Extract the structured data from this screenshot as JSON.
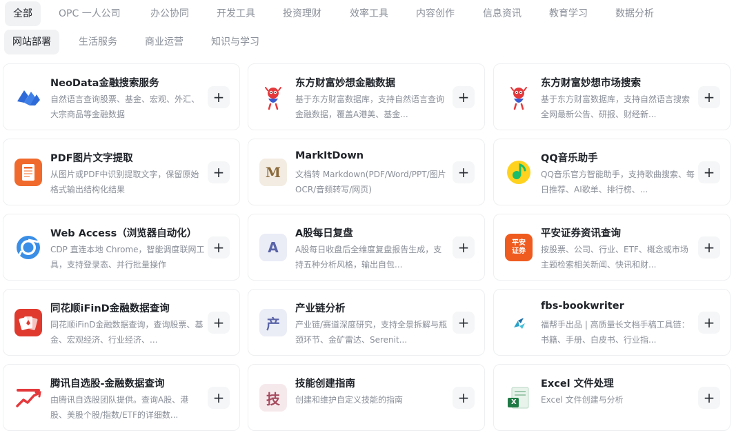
{
  "tabs": [
    {
      "label": "全部",
      "active": true
    },
    {
      "label": "OPC 一人公司"
    },
    {
      "label": "办公协同"
    },
    {
      "label": "开发工具"
    },
    {
      "label": "投资理财"
    },
    {
      "label": "效率工具"
    },
    {
      "label": "内容创作"
    },
    {
      "label": "信息资讯"
    },
    {
      "label": "教育学习"
    },
    {
      "label": "数据分析"
    },
    {
      "label": "网站部署"
    },
    {
      "label": "生活服务"
    },
    {
      "label": "商业运营"
    },
    {
      "label": "知识与学习"
    }
  ],
  "add_symbol": "+",
  "cards": [
    {
      "title": "NeoData金融搜索服务",
      "desc": "自然语言查询股票、基金、宏观、外汇、大宗商品等金融数据",
      "icon": "neodata-logo"
    },
    {
      "title": "东方财富妙想金融数据",
      "desc": "基于东方财富数据库，支持自然语言查询金融数据，覆盖A港美、基金...",
      "icon": "eastmoney-mascot"
    },
    {
      "title": "东方财富妙想市场搜索",
      "desc": "基于东方财富数据库，支持自然语言搜索全网最新公告、研报、财经新...",
      "icon": "eastmoney-mascot"
    },
    {
      "title": "PDF图片文字提取",
      "desc": "从图片或PDF中识别提取文字，保留原始格式输出结构化结果",
      "icon": "document-icon"
    },
    {
      "title": "MarkItDown",
      "desc": "文档转 Markdown(PDF/Word/PPT/图片OCR/音频转写/网页)",
      "icon": "letter",
      "letter": "M"
    },
    {
      "title": "QQ音乐助手",
      "desc": "QQ音乐官方智能助手，支持歌曲搜索、每日推荐、AI歌单、排行榜、...",
      "icon": "qqmusic-logo"
    },
    {
      "title": "Web Access（浏览器自动化）",
      "desc": "CDP 直连本地 Chrome，智能调度联网工具，支持登录态、并行批量操作",
      "icon": "chrome-icon"
    },
    {
      "title": "A股每日复盘",
      "desc": "A股每日收盘后全维度复盘报告生成，支持五种分析风格，输出自包...",
      "icon": "letter",
      "letter": "A"
    },
    {
      "title": "平安证券资讯查询",
      "desc": "按股票、公司、行业、ETF、概念或市场主题检索相关新闻、快讯和财...",
      "icon": "pingan-logo",
      "logo_line1": "平安",
      "logo_line2": "证券"
    },
    {
      "title": "同花顺iFinD金融数据查询",
      "desc": "同花顺iFinD金融数据查询，查询股票、基金、宏观经济、行业经济、...",
      "icon": "ths-logo"
    },
    {
      "title": "产业链分析",
      "desc": "产业链/赛道深度研究，支持全景拆解与瓶颈环节、金矿雷达、Serenit...",
      "icon": "letter",
      "letter": "产"
    },
    {
      "title": "fbs-bookwriter",
      "desc": "福帮手出品 | 高质量长文档手稿工具链：书籍、手册、白皮书、行业指...",
      "icon": "fbs-logo"
    },
    {
      "title": "腾讯自选股-金融数据查询",
      "desc": "由腾讯自选股团队提供。查询A股、港股、美股个股/指数/ETF的详细数...",
      "icon": "tencent-stock-logo"
    },
    {
      "title": "技能创建指南",
      "desc": "创建和维护自定义技能的指南",
      "icon": "letter",
      "letter": "技"
    },
    {
      "title": "Excel 文件处理",
      "desc": "Excel 文件创建与分析",
      "icon": "excel-icon",
      "letter": "X"
    }
  ],
  "colors": {
    "tab_active_bg": "#f1f2f4",
    "muted_text": "#8a8f99",
    "neodata_blue": "#2f6bd8",
    "eastmoney_red": "#e4393c",
    "pdf_orange": "#f06a2d",
    "qqmusic_yellow": "#ffd21f",
    "qqmusic_green": "#1bbd6a",
    "chrome_blue": "#3a8ee6",
    "pingan_orange": "#ef5b1f",
    "ths_red": "#e03a2e",
    "excel_green": "#1f7a45"
  }
}
